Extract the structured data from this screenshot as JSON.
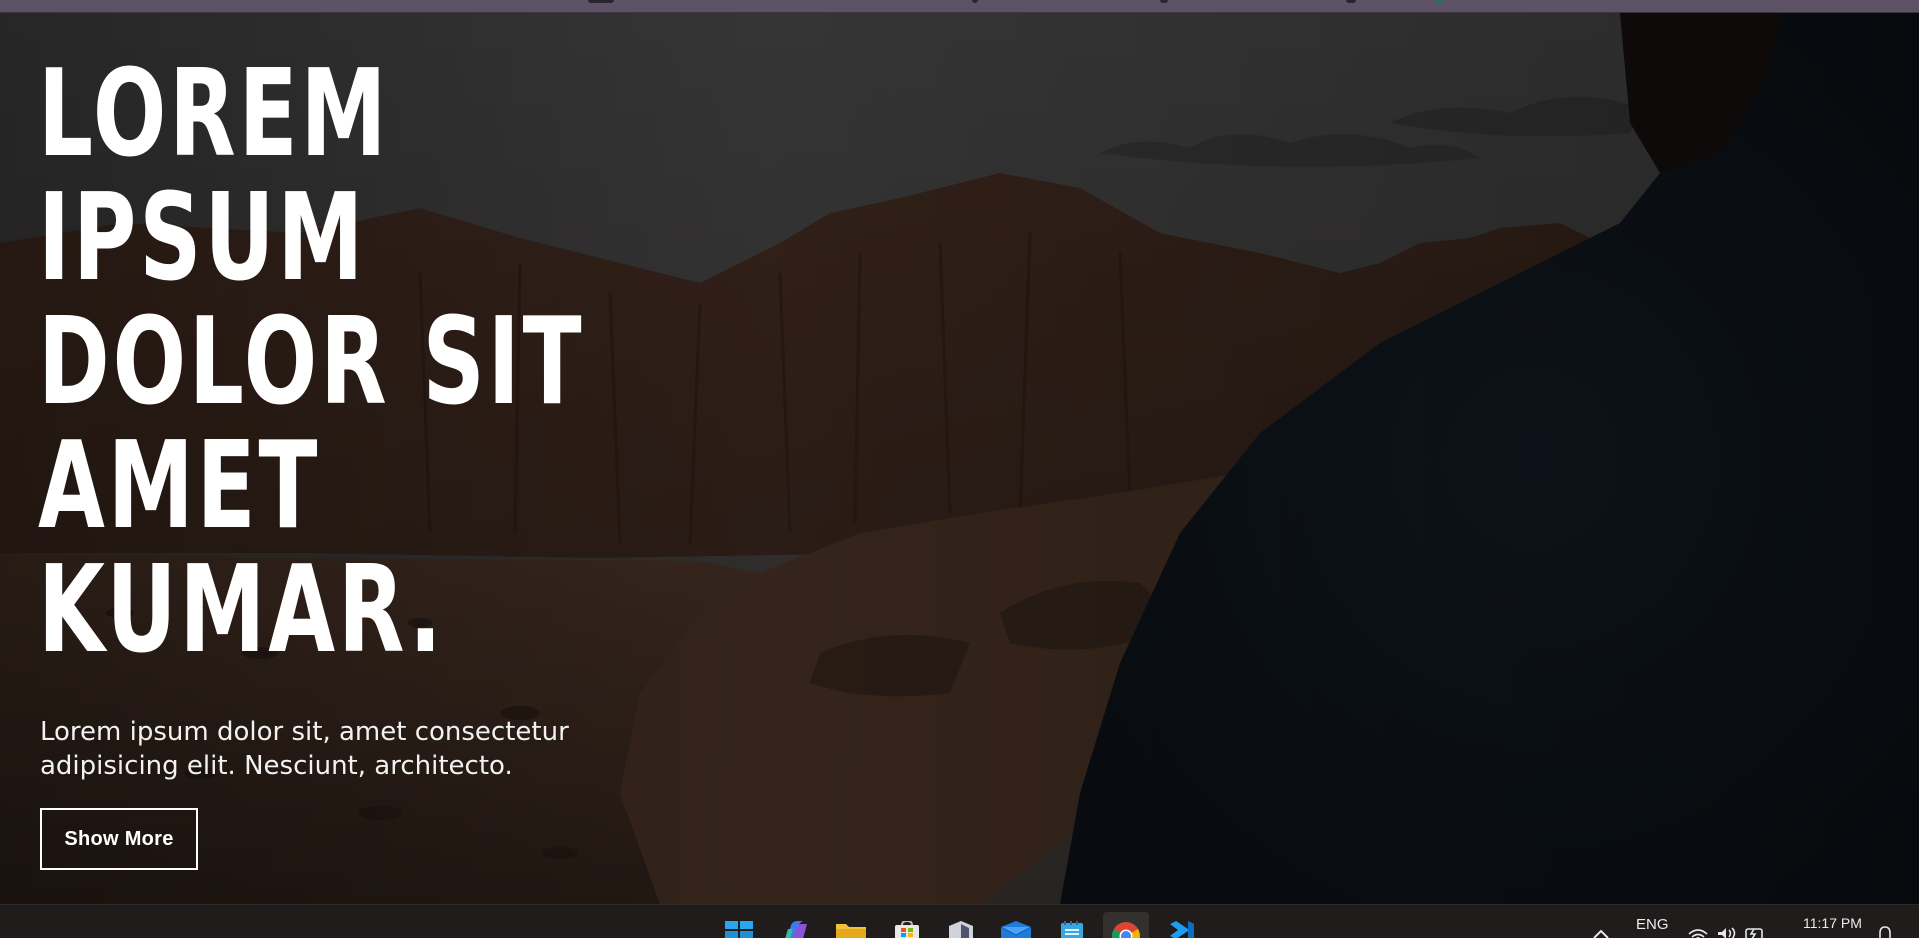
{
  "hero": {
    "headline_lines": [
      "LOREM",
      "IPSUM",
      "DOLOR SIT",
      "AMET",
      "KUMAR."
    ],
    "subtext_line1": "Lorem ipsum dolor sit, amet consectetur",
    "subtext_line2": "adipisicing elit. Nesciunt, architecto.",
    "button_label": "Show More"
  },
  "taskbar": {
    "pinned": [
      "start-icon",
      "copilot-icon",
      "file-explorer-icon",
      "store-icon",
      "security-icon",
      "mail-icon",
      "notepad-icon",
      "chrome-icon",
      "vscode-icon"
    ],
    "active_app": "chrome-icon",
    "language": "ENG",
    "time": "11:17 PM"
  },
  "colors": {
    "text": "#ffffff",
    "taskbar": "#1f1c1b",
    "top_strip": "#5d5166"
  }
}
